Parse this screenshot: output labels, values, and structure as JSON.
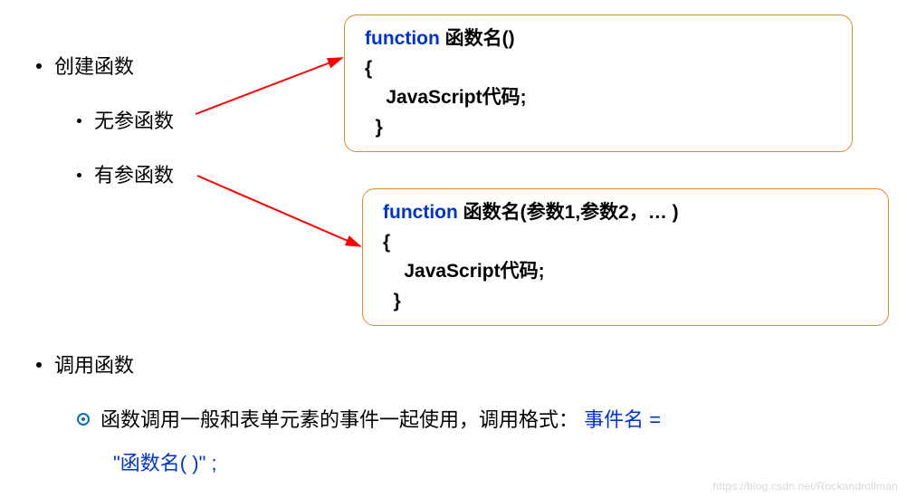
{
  "bullets": {
    "create": "创建函数",
    "noparam": "无参函数",
    "withparam": "有参函数",
    "call": "调用函数"
  },
  "code1": {
    "keyword": "function",
    "name_part": " 函数名()",
    "open": " {",
    "body": "    JavaScript代码;",
    "close": "  }"
  },
  "code2": {
    "keyword": "function",
    "name_part": " 函数名(参数1,参数2，… )",
    "open": " {",
    "body": "    JavaScript代码;",
    "close": "  }"
  },
  "paragraph": {
    "lead": "函数调用一般和表单元素的事件一起使用，调用格式：",
    "blue1": " 事件名 =",
    "blue2": "\"函数名( )\" ;"
  },
  "watermark": "https://blog.csdn.net/Rockandrollman"
}
